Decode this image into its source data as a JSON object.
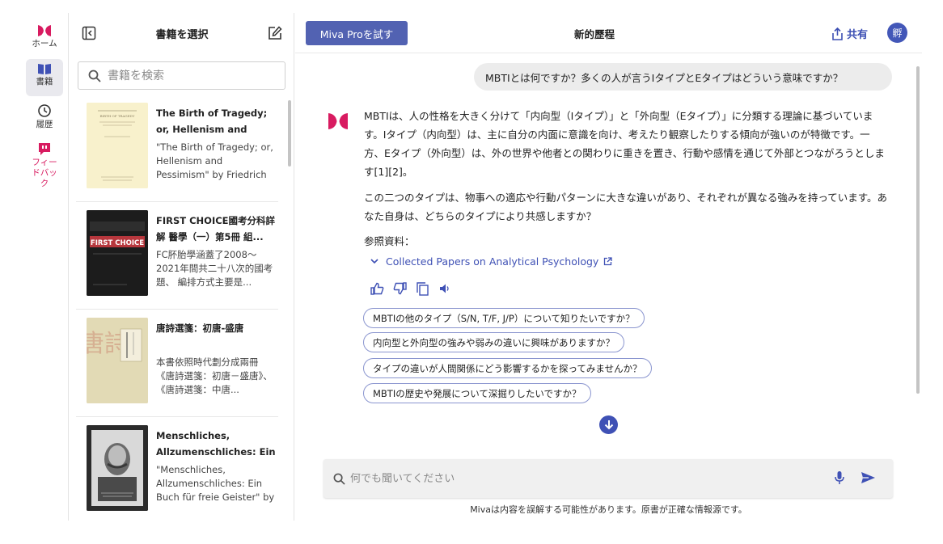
{
  "rail": {
    "home_label": "ホーム",
    "books_label": "書籍",
    "history_label": "履歴",
    "feedback_label": "フィードバック"
  },
  "books_panel": {
    "title": "書籍を選択",
    "search_placeholder": "書籍を検索",
    "items": [
      {
        "title": "The Birth of Tragedy; or, Hellenism and Pessimi...",
        "desc": "\"The Birth of Tragedy; or, Hellenism and Pessimism\" by Friedrich Wilhelm...",
        "cover_text": "BIRTH OF TRAGEDY"
      },
      {
        "title": "FIRST CHOICE國考分科詳解 醫學（一）第5冊 組...",
        "desc": "FC肧胎學涵蓋了2008～2021年間共二十八次的國考題、 編排方式主要是...",
        "cover_text": "FIRST CHOICE"
      },
      {
        "title": "唐詩選箋：初唐-盛唐",
        "desc": "本書依照時代劃分成兩冊《唐詩選箋：初唐－盛唐》、《唐詩選箋：中唐...",
        "cover_text": "唐詩"
      },
      {
        "title": "Menschliches, Allzumenschliches: Ein Buch Fuer ...",
        "desc": "\"Menschliches, Allzumenschliches: Ein Buch für freie Geister\" by Friedrich...",
        "cover_text": ""
      }
    ]
  },
  "header": {
    "pro_button": "Miva Proを試す",
    "title": "新的歷程",
    "share_label": "共有",
    "avatar_text": "孵"
  },
  "conversation": {
    "user_message": "MBTIとは何ですか？多くの人が言うIタイプとEタイプはどういう意味ですか？",
    "answer_p1": "MBTIは、人の性格を大きく分けて「内向型（Iタイプ）」と「外向型（Eタイプ）」に分類する理論に基づいています。Iタイプ（内向型）は、主に自分の内面に意識を向け、考えたり観察したりする傾向が強いのが特徴です。一方、Eタイプ（外向型）は、外の世界や他者との関わりに重きを置き、行動や感情を通じて外部とつながろうとします[1][2]。",
    "answer_p2": "この二つのタイプは、物事への適応や行動パターンに大きな違いがあり、それぞれが異なる強みを持っています。あなた自身は、どちらのタイプにより共感しますか？",
    "references_label": "参照資料：",
    "reference_title": "Collected Papers on Analytical Psychology",
    "suggestions": [
      "MBTIの他のタイプ（S/N, T/F, J/P）について知りたいですか？",
      "内向型と外向型の強みや弱みの違いに興味がありますか？",
      "タイプの違いが人間関係にどう影響するかを探ってみませんか？",
      "MBTIの歴史や発展について深掘りしたいですか？"
    ]
  },
  "input": {
    "placeholder": "何でも聞いてください"
  },
  "disclaimer": "Mivaは内容を誤解する可能性があります。原書が正確な情報源です。",
  "colors": {
    "accent": "#3f51b5",
    "brand": "#d81b60",
    "pro_button": "#5262b2"
  }
}
